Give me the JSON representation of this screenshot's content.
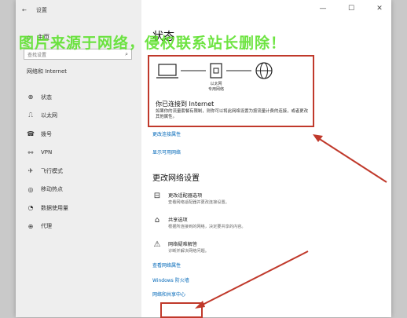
{
  "titlebar": {
    "back": "←",
    "title": "设置",
    "minimize": "—",
    "maximize": "☐",
    "close": "✕"
  },
  "sidebar": {
    "home_label": "主页",
    "search_placeholder": "查找设置",
    "section_title": "网络和 Internet",
    "items": [
      {
        "label": "状态",
        "icon": "globe-icon",
        "glyph": "⊕"
      },
      {
        "label": "以太网",
        "icon": "ethernet-icon",
        "glyph": "⎍"
      },
      {
        "label": "拨号",
        "icon": "phone-icon",
        "glyph": "☎"
      },
      {
        "label": "VPN",
        "icon": "vpn-icon",
        "glyph": "⚯"
      },
      {
        "label": "飞行模式",
        "icon": "airplane-icon",
        "glyph": "✈"
      },
      {
        "label": "移动热点",
        "icon": "hotspot-icon",
        "glyph": "◎"
      },
      {
        "label": "数据使用量",
        "icon": "data-usage-icon",
        "glyph": "◔"
      },
      {
        "label": "代理",
        "icon": "proxy-icon",
        "glyph": "⊕"
      }
    ]
  },
  "main": {
    "title": "状态",
    "diagram": {
      "ethernet_line1": "以太网",
      "ethernet_line2": "专用网络"
    },
    "connected_text": "你已连接到 Internet",
    "description": "如果你的流量套餐有限制，则你可以将此网络设置为按流量计费的连接，或者更改其他属性。",
    "link_change_props": "更改连接属性",
    "link_show_networks": "显示可用网络",
    "section_title": "更改网络设置",
    "options": [
      {
        "title": "更改适配器选项",
        "subtitle": "查看网络适配器并更改连接设置。",
        "icon": "adapter-icon",
        "glyph": "⊟"
      },
      {
        "title": "共享选项",
        "subtitle": "根据所连接到的网络，决定要共享的内容。",
        "icon": "share-icon",
        "glyph": "⌂"
      },
      {
        "title": "网络疑难解答",
        "subtitle": "诊断并解决网络问题。",
        "icon": "warning-icon",
        "glyph": "⚠"
      }
    ],
    "link_hardware": "查看网络属性",
    "link_firewall": "Windows 防火墙",
    "link_sharing_center": "网络和共享中心"
  },
  "watermark": "图片来源于网络，侵权联系站长删除！",
  "colors": {
    "accent": "#0067b8",
    "highlight": "#c0392b",
    "watermark": "#55e022"
  }
}
